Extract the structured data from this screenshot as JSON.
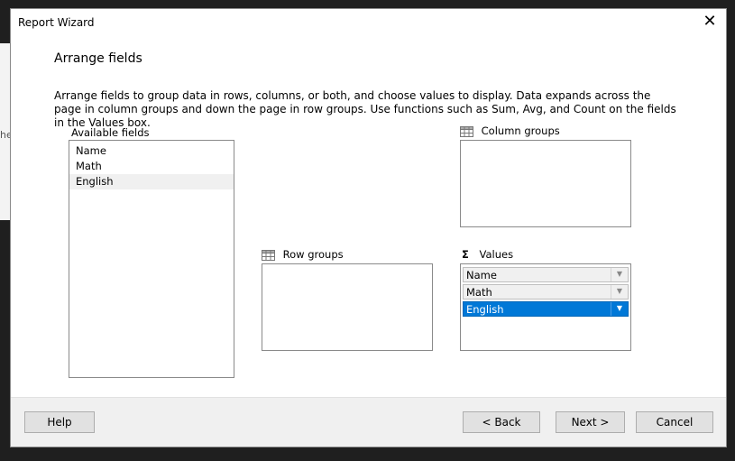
{
  "background": {
    "partial_text": "he"
  },
  "dialog": {
    "title": "Report Wizard",
    "close_glyph": "✕",
    "heading": "Arrange fields",
    "description": "Arrange fields to group data in rows, columns, or both, and choose values to display. Data expands across the page in column groups and down the page in row groups.  Use functions such as Sum, Avg, and Count on the fields in the Values box."
  },
  "available_fields": {
    "label": "Available fields",
    "items": [
      "Name",
      "Math",
      "English"
    ],
    "selected_index": 2
  },
  "column_groups": {
    "label": "Column groups",
    "icon": "table-grid-icon"
  },
  "row_groups": {
    "label": "Row groups",
    "icon": "table-grid-icon"
  },
  "values": {
    "label": "Values",
    "icon_glyph": "Σ",
    "items": [
      "Name",
      "Math",
      "English"
    ],
    "selected_index": 2,
    "dropdown_glyph": "▼"
  },
  "buttons": {
    "help": "Help",
    "back": "< Back",
    "next": "Next >",
    "cancel": "Cancel"
  },
  "colors": {
    "selection": "#0078d7",
    "footer": "#f0f0f0"
  }
}
